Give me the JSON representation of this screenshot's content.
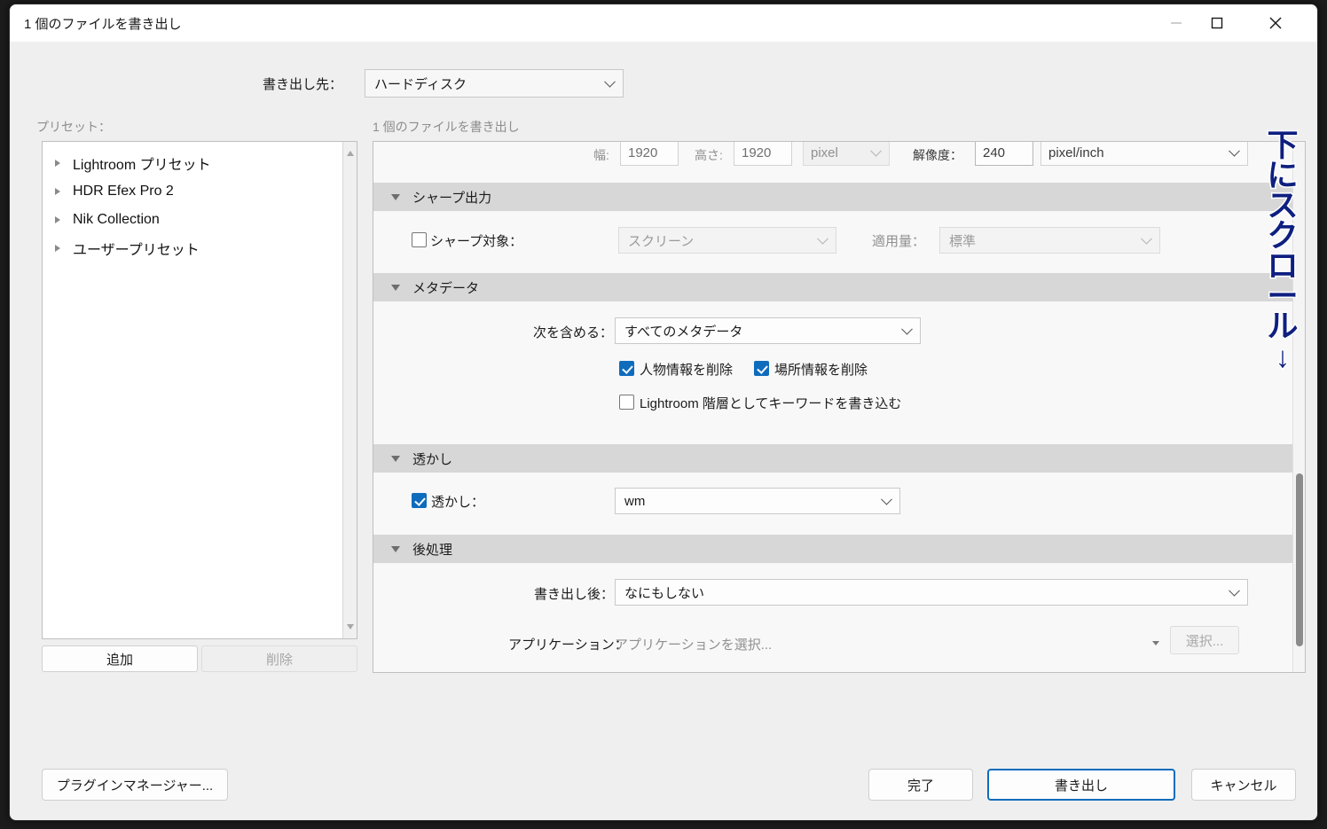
{
  "window": {
    "title": "1 個のファイルを書き出し",
    "controls": {
      "minimize": "—",
      "maximize": "□",
      "close": "✕"
    }
  },
  "header": {
    "destination_label": "書き出し先：",
    "destination_value": "ハードディスク"
  },
  "presets": {
    "label": "プリセット：",
    "items": [
      {
        "label": "Lightroom プリセット"
      },
      {
        "label": "HDR Efex Pro 2"
      },
      {
        "label": "Nik Collection"
      },
      {
        "label": "ユーザープリセット"
      }
    ],
    "add_button": "追加",
    "delete_button": "削除"
  },
  "right_panel": {
    "label": "1 個のファイルを書き出し",
    "image_sizing": {
      "width_label": "幅:",
      "width_value": "1920",
      "height_label": "高さ:",
      "height_value": "1920",
      "unit_value": "pixel",
      "resolution_label": "解像度：",
      "resolution_value": "240",
      "resolution_unit": "pixel/inch"
    },
    "sharpening": {
      "section_title": "シャープ出力",
      "checkbox_label": "シャープ対象：",
      "checkbox_checked": false,
      "target_value": "スクリーン",
      "amount_label": "適用量：",
      "amount_value": "標準"
    },
    "metadata": {
      "section_title": "メタデータ",
      "include_label": "次を含める：",
      "include_value": "すべてのメタデータ",
      "remove_person_label": "人物情報を削除",
      "remove_person_checked": true,
      "remove_location_label": "場所情報を削除",
      "remove_location_checked": true,
      "keyword_hierarchy_label": "Lightroom 階層としてキーワードを書き込む",
      "keyword_hierarchy_checked": false
    },
    "watermark": {
      "section_title": "透かし",
      "checkbox_label": "透かし：",
      "checkbox_checked": true,
      "value": "wm"
    },
    "post_processing": {
      "section_title": "後処理",
      "after_export_label": "書き出し後：",
      "after_export_value": "なにもしない",
      "application_label": "アプリケーション：",
      "application_placeholder": "アプリケーションを選択...",
      "choose_button": "選択..."
    }
  },
  "annotation": {
    "text": "下にスクロール",
    "chars": [
      "下",
      "に",
      "ス",
      "ク",
      "ロ",
      "ー",
      "ル"
    ],
    "arrow": "↓",
    "color": "#0e1f80"
  },
  "footer": {
    "plugin_manager": "プラグインマネージャー...",
    "done": "完了",
    "export": "書き出し",
    "cancel": "キャンセル"
  }
}
